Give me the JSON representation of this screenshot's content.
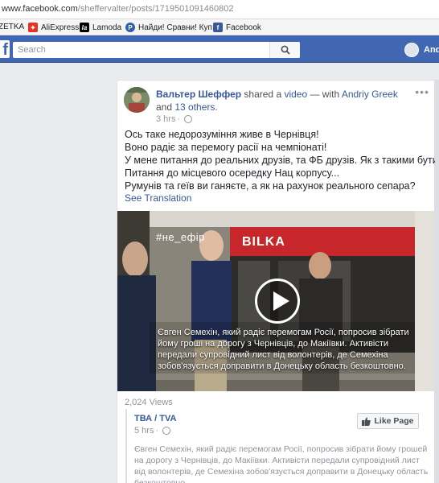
{
  "browser": {
    "url_main": "www.facebook.com",
    "url_path": "/sheffervalter/posts/1719501091460802"
  },
  "bookmarks": [
    {
      "label": "ZETKA",
      "icon": "rozetka-icon",
      "color": "#00a046"
    },
    {
      "label": "AliExpress",
      "icon": "aliexpress-icon",
      "color": "#e43225"
    },
    {
      "label": "Lamoda",
      "icon": "lamoda-icon",
      "color": "#000000"
    },
    {
      "label": "Найди! Сравни! Куп",
      "icon": "price-icon",
      "color": "#2f5fa8"
    },
    {
      "label": "Facebook",
      "icon": "facebook-icon",
      "color": "#3b5998"
    }
  ],
  "fb": {
    "search_placeholder": "Search",
    "user_name": "Andi"
  },
  "post": {
    "author": "Вальтер Шеффер",
    "action": " shared a ",
    "object": "video",
    "with_prefix": " — with ",
    "tagged": "Andriy Greek",
    "and": " and ",
    "others": "13 others",
    "period": ".",
    "time": "3 hrs",
    "lines": [
      "Ось таке недорозуміння живе в Чернівця!",
      "Воно радіє за перемогу расії на чемпіонаті!",
      "У мене питання до реальних друзів, та ФБ друзів. Як з такими бути?",
      "Питання до місцевого осередку Нац корпусу...",
      "Румунів та геїв ви ганяєте, а як на рахунок реального сепара?"
    ],
    "see_translation": "See Translation",
    "video": {
      "hashtag": "#не_ефір",
      "store_sign": "BILKA",
      "caption": "Євген Семехін, який радіє перемогам Росії, попросив зібрати йому гроші на дорогу з Чернівців, до Макіївки. Активісти передали супровідний лист від волонтерів, де Семехіна зобов'язується доправити в Донецьку область безкоштовно."
    },
    "views": "2,024 Views",
    "shared_post": {
      "source": "ТВА / TVA",
      "time": "5 hrs",
      "like_page": "Like Page",
      "text": "Євген Семехін, який радіє перемогам Росії, попросив зібрати йому грошей на дорогу з Чернівців, до Макіївки. Активісти передали супровідний лист від волонтерів, де Семехіна зобов'язується доправити в Донецьку область безкоштовно"
    }
  }
}
